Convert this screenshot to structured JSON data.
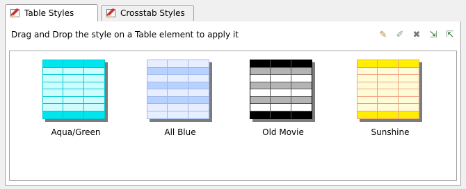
{
  "tabs": [
    {
      "label": "Table Styles",
      "icon": "table-style-icon",
      "active": true
    },
    {
      "label": "Crosstab Styles",
      "icon": "crosstab-style-icon",
      "active": false
    }
  ],
  "header": {
    "instruction": "Drag and Drop the style on a Table element to apply it"
  },
  "toolbar": {
    "buttons": [
      {
        "name": "new-style-icon",
        "glyph": "✎"
      },
      {
        "name": "edit-style-icon",
        "glyph": "✐"
      },
      {
        "name": "delete-style-icon",
        "glyph": "✖"
      },
      {
        "name": "import-style-icon",
        "glyph": "⇲"
      },
      {
        "name": "export-style-icon",
        "glyph": "⇱"
      }
    ]
  },
  "styles": [
    {
      "label": "Aqua/Green",
      "colors": {
        "header": "#00e5ee",
        "body": "#ccfdff",
        "alt": "#ccfdff",
        "line": "#00c8d0",
        "footer": "#00e5ee",
        "border": "#00c8d0"
      }
    },
    {
      "label": "All Blue",
      "colors": {
        "header": "#e7eeff",
        "body": "#e7eeff",
        "alt": "#b8d2ff",
        "line": "#9fb8ea",
        "footer": "#e7eeff",
        "border": "#9fb8ea"
      }
    },
    {
      "label": "Old Movie",
      "colors": {
        "header": "#000000",
        "body": "#ffffff",
        "alt": "#b4b4b4",
        "line": "#555555",
        "footer": "#000000",
        "border": "#000000"
      }
    },
    {
      "label": "Sunshine",
      "colors": {
        "header": "#ffee00",
        "body": "#fffbd6",
        "alt": "#fffbd6",
        "line": "#f0a080",
        "footer": "#ffee00",
        "border": "#f0a080"
      }
    }
  ]
}
